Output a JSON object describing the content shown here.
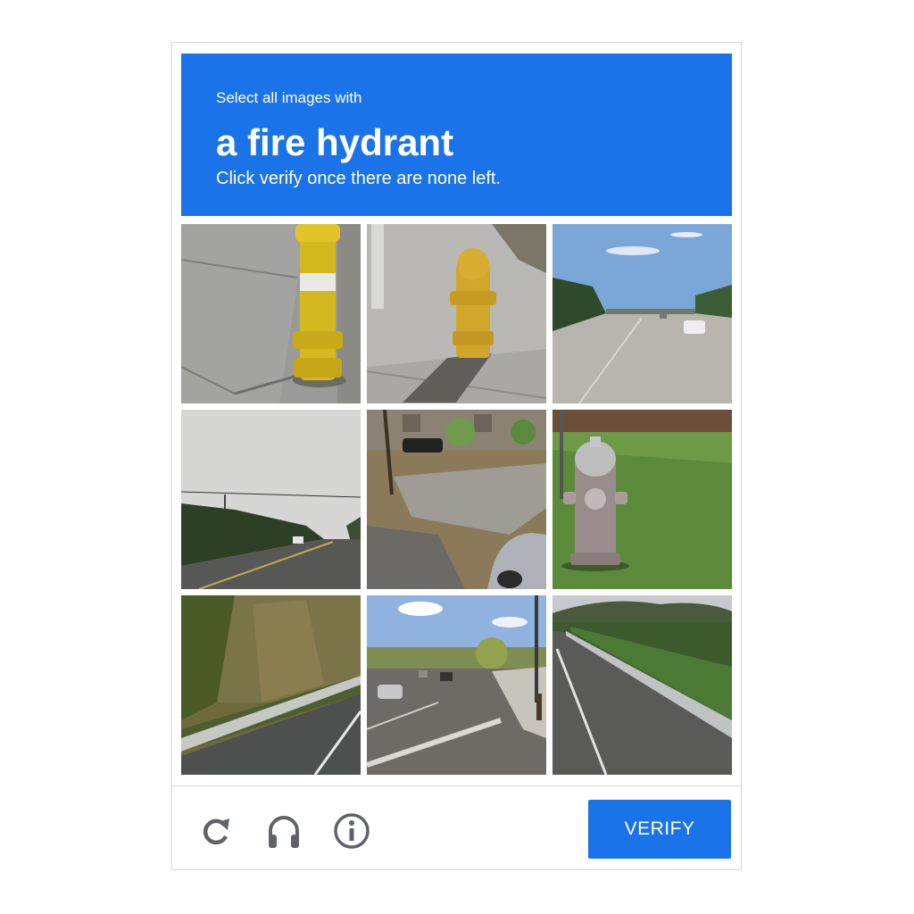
{
  "header": {
    "instruction": "Select all images with",
    "target": "a fire hydrant",
    "subtext": "Click verify once there are none left."
  },
  "tiles": [
    {
      "id": 1,
      "content": "yellow fire hydrant on sidewalk"
    },
    {
      "id": 2,
      "content": "yellow fire hydrant on sidewalk with shadow"
    },
    {
      "id": 3,
      "content": "road with car"
    },
    {
      "id": 4,
      "content": "road under cloudy sky"
    },
    {
      "id": 5,
      "content": "sidewalk with parked car"
    },
    {
      "id": 6,
      "content": "silver fire hydrant on grass"
    },
    {
      "id": 7,
      "content": "wooded hillside with road"
    },
    {
      "id": 8,
      "content": "street intersection with cars"
    },
    {
      "id": 9,
      "content": "highway with guardrail"
    }
  ],
  "footer": {
    "reload_icon": "reload-icon",
    "audio_icon": "headphones-icon",
    "info_icon": "info-icon",
    "verify_label": "VERIFY"
  },
  "colors": {
    "accent": "#1a73e8",
    "icon": "#5f6368"
  }
}
